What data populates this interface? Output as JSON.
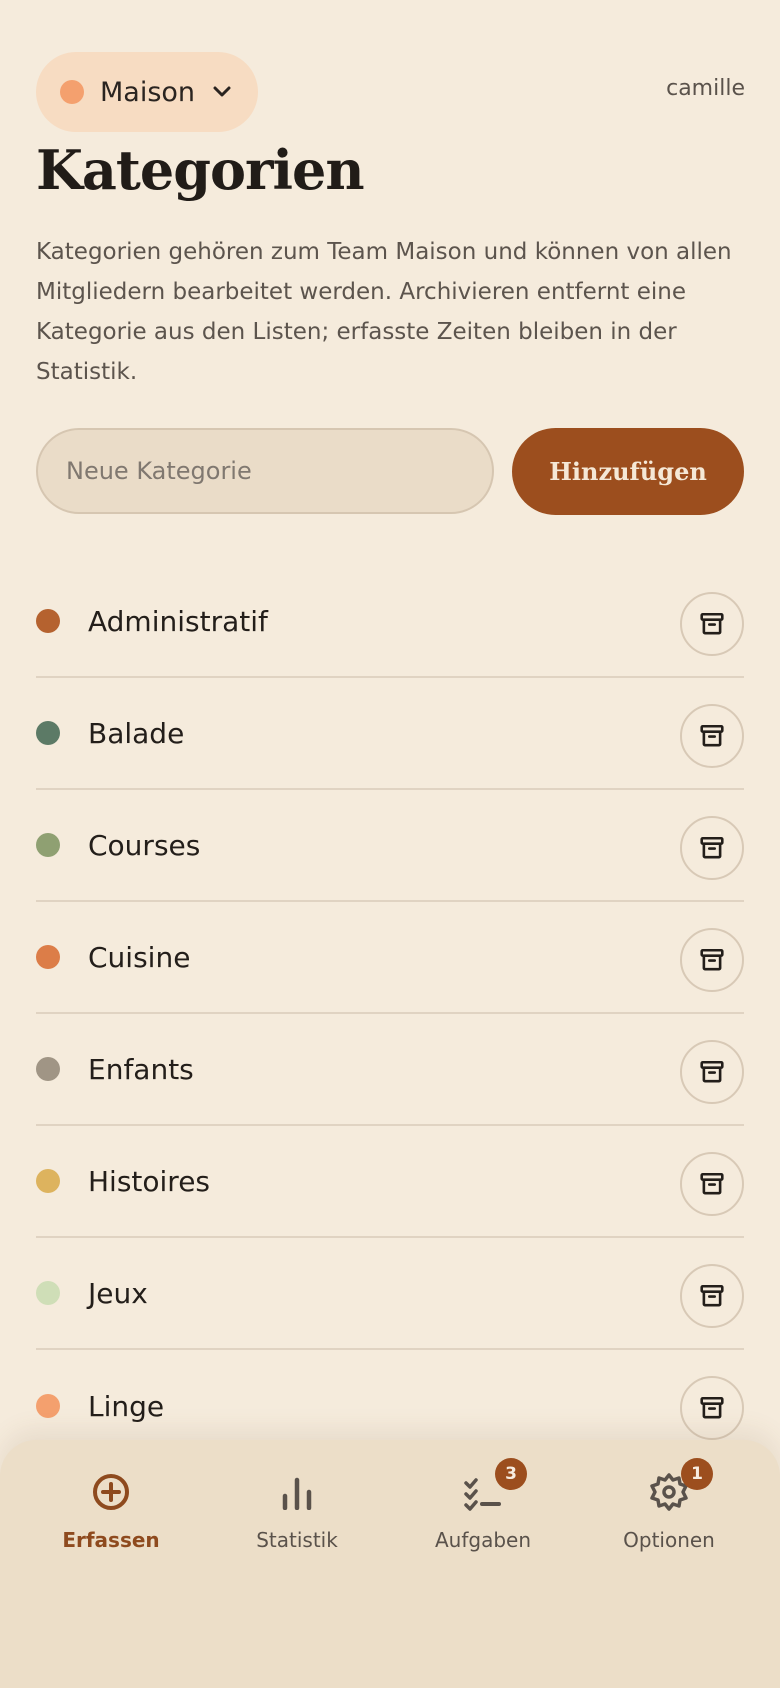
{
  "header": {
    "team_name": "Maison",
    "team_color": "#f4a06e",
    "user_name": "camille"
  },
  "page": {
    "title": "Kategorien",
    "description": "Kategorien gehören zum Team Maison und können von allen Mitgliedern bearbeitet werden. Archivieren entfernt eine Kategorie aus den Listen; erfasste Zeiten bleiben in der Statistik."
  },
  "new_category": {
    "placeholder": "Neue Kategorie",
    "value": "",
    "add_label": "Hinzufügen"
  },
  "categories": [
    {
      "label": "Administratif",
      "color": "#b5622f"
    },
    {
      "label": "Balade",
      "color": "#5c7a66"
    },
    {
      "label": "Courses",
      "color": "#8fa072"
    },
    {
      "label": "Cuisine",
      "color": "#dc7d48"
    },
    {
      "label": "Enfants",
      "color": "#a09585"
    },
    {
      "label": "Histoires",
      "color": "#ddb35e"
    },
    {
      "label": "Jeux",
      "color": "#cfdeb7"
    },
    {
      "label": "Linge",
      "color": "#f4a06e"
    }
  ],
  "nav": {
    "items": [
      {
        "label": "Erfassen",
        "icon": "plus-circle-icon",
        "active": true
      },
      {
        "label": "Statistik",
        "icon": "bar-chart-icon",
        "active": false
      },
      {
        "label": "Aufgaben",
        "icon": "checklist-icon",
        "active": false,
        "badge": "3"
      },
      {
        "label": "Optionen",
        "icon": "gear-icon",
        "active": false,
        "badge": "1"
      }
    ]
  },
  "colors": {
    "background": "#f5ebdc",
    "accent": "#9c4e1e"
  }
}
